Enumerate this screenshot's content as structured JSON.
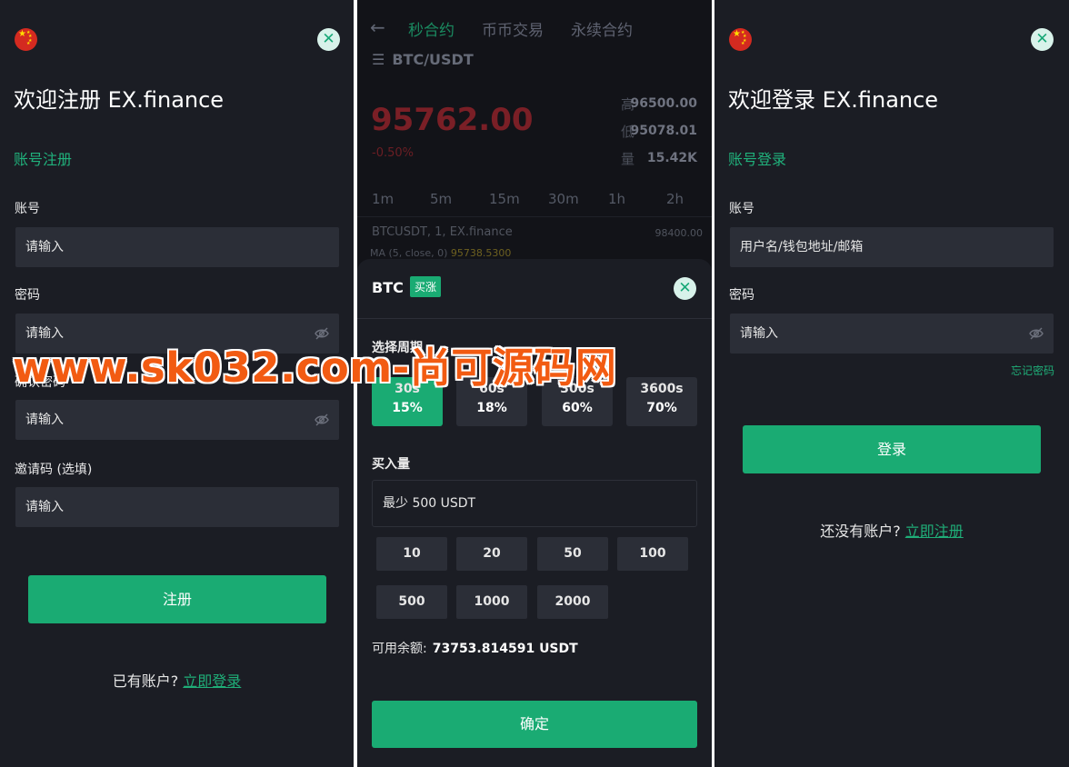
{
  "register": {
    "title": "欢迎注册 EX.finance",
    "subtab": "账号注册",
    "account_label": "账号",
    "account_placeholder": "请输入",
    "password_label": "密码",
    "password_placeholder": "请输入",
    "confirm_label": "确认密码",
    "confirm_placeholder": "请输入",
    "invite_label": "邀请码 (选填)",
    "invite_placeholder": "请输入",
    "submit": "注册",
    "footer_text": "已有账户?",
    "footer_link": "立即登录",
    "close_glyph": "✕"
  },
  "trade": {
    "back_glyph": "←",
    "tabs": [
      "秒合约",
      "币币交易",
      "永续合约"
    ],
    "pair": "BTC/USDT",
    "price": "95762.00",
    "change": "-0.50%",
    "stats": [
      {
        "label": "高",
        "value": "96500.00"
      },
      {
        "label": "低",
        "value": "95078.01"
      },
      {
        "label": "量",
        "value": "15.42K"
      }
    ],
    "timeframes": [
      "1m",
      "5m",
      "15m",
      "30m",
      "1h",
      "2h"
    ],
    "chart_symbol": "BTCUSDT, 1, EX.finance",
    "chart_right_price": "98400.00",
    "ma_label": "MA (5, close, 0)",
    "ma_value": "95738.5300",
    "sheet": {
      "coin": "BTC",
      "direction_tag": "买涨",
      "close_glyph": "✕",
      "period_label": "选择周期",
      "periods": [
        {
          "time": "30s",
          "rate": "15%"
        },
        {
          "time": "60s",
          "rate": "18%"
        },
        {
          "time": "300s",
          "rate": "60%"
        },
        {
          "time": "3600s",
          "rate": "70%"
        }
      ],
      "amount_label": "买入量",
      "amount_placeholder": "最少 500 USDT",
      "quick_amounts": [
        "10",
        "20",
        "50",
        "100",
        "500",
        "1000",
        "2000"
      ],
      "balance_label": "可用余额:",
      "balance_value": "73753.814591 USDT",
      "confirm": "确定"
    }
  },
  "login": {
    "title": "欢迎登录 EX.finance",
    "subtab": "账号登录",
    "account_label": "账号",
    "account_placeholder": "用户名/钱包地址/邮箱",
    "password_label": "密码",
    "password_placeholder": "请输入",
    "forgot": "忘记密码",
    "submit": "登录",
    "footer_text": "还没有账户?",
    "footer_link": "立即注册",
    "close_glyph": "✕"
  },
  "watermark": "www.sk032.com-尚可源码网",
  "colors": {
    "accent": "#1aab73",
    "background": "#1b1d24",
    "input": "#2b2e37",
    "watermark": "#f25b12"
  }
}
